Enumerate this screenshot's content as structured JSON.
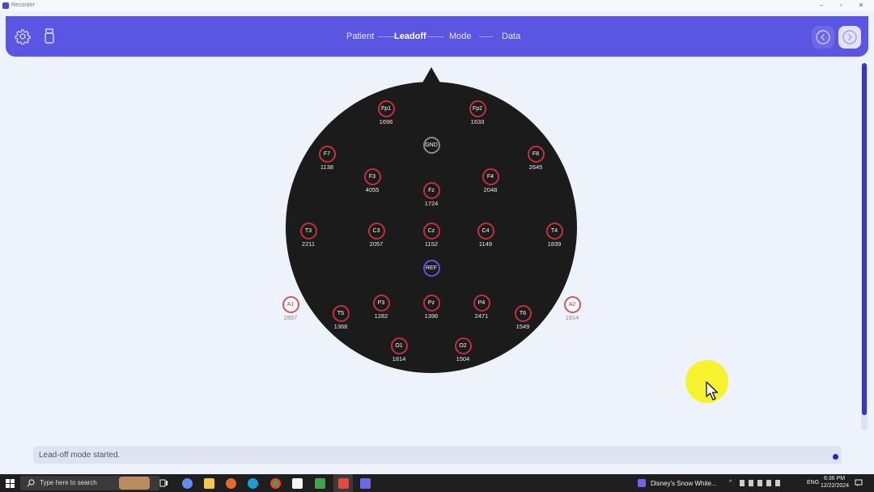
{
  "window": {
    "title": "Recorder"
  },
  "header": {
    "steps": [
      {
        "label": "Patient",
        "active": false
      },
      {
        "label": "Leadoff",
        "active": true
      },
      {
        "label": "Mode",
        "active": false
      },
      {
        "label": "Data",
        "active": false
      }
    ],
    "icons": [
      "gear-icon",
      "usb-device-icon",
      "back-icon",
      "forward-icon"
    ],
    "accent": "#5a55e3"
  },
  "electrodes": {
    "Fp1": {
      "label": "Fp1",
      "value": "1696"
    },
    "Fp2": {
      "label": "Fp2",
      "value": "1633"
    },
    "GND": {
      "label": "GND",
      "value": ""
    },
    "F7": {
      "label": "F7",
      "value": "1138"
    },
    "F8": {
      "label": "F8",
      "value": "2645"
    },
    "F3": {
      "label": "F3",
      "value": "4055"
    },
    "F4": {
      "label": "F4",
      "value": "2048"
    },
    "Fz": {
      "label": "Fz",
      "value": "1724"
    },
    "T3": {
      "label": "T3",
      "value": "2211"
    },
    "C3": {
      "label": "C3",
      "value": "2057"
    },
    "Cz": {
      "label": "Cz",
      "value": "1152"
    },
    "C4": {
      "label": "C4",
      "value": "1149"
    },
    "T4": {
      "label": "T4",
      "value": "1839"
    },
    "REF": {
      "label": "REF",
      "value": ""
    },
    "A1": {
      "label": "A1",
      "value": "2857"
    },
    "A2": {
      "label": "A2",
      "value": "1914"
    },
    "T5": {
      "label": "T5",
      "value": "1368"
    },
    "P3": {
      "label": "P3",
      "value": "1282"
    },
    "Pz": {
      "label": "Pz",
      "value": "1396"
    },
    "P4": {
      "label": "P4",
      "value": "2471"
    },
    "T6": {
      "label": "T6",
      "value": "1549"
    },
    "O1": {
      "label": "O1",
      "value": "1814"
    },
    "O2": {
      "label": "O2",
      "value": "1504"
    }
  },
  "electrode_colors": {
    "active_ring": "#c4303a",
    "gnd_ring": "#8c8c8c",
    "ref_ring": "#5b57e0"
  },
  "status": {
    "message": "Lead-off mode started."
  },
  "taskbar": {
    "search_placeholder": "Type here to search",
    "active_window": "Disney's Snow White...",
    "language": "ENG",
    "time": "6:36 PM",
    "date": "12/22/2024"
  }
}
